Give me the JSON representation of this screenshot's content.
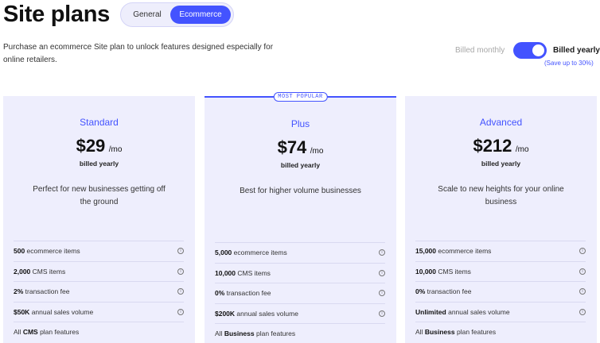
{
  "header": {
    "title": "Site plans",
    "tabs": [
      {
        "label": "General",
        "active": false
      },
      {
        "label": "Ecommerce",
        "active": true
      }
    ]
  },
  "intro": "Purchase an ecommerce Site plan to unlock features designed especially for online retailers.",
  "billing": {
    "monthly_label": "Billed monthly",
    "yearly_label": "Billed yearly",
    "save_note": "(Save up to 30%)",
    "yearly_selected": true
  },
  "plans": [
    {
      "name": "Standard",
      "price": "$29",
      "per": "/mo",
      "billed": "billed yearly",
      "desc": "Perfect for new businesses getting off the ground",
      "features": [
        {
          "strong": "500",
          "text": " ecommerce items"
        },
        {
          "strong": "2,000",
          "text": " CMS items"
        },
        {
          "strong": "2%",
          "text": " transaction fee"
        },
        {
          "strong": "$50K",
          "text": " annual sales volume"
        },
        {
          "pre": "All ",
          "strong": "CMS",
          "text": " plan features"
        }
      ]
    },
    {
      "name": "Plus",
      "badge": "MOST POPULAR",
      "price": "$74",
      "per": "/mo",
      "billed": "billed yearly",
      "desc": "Best for higher volume businesses",
      "features": [
        {
          "strong": "5,000",
          "text": " ecommerce items"
        },
        {
          "strong": "10,000",
          "text": " CMS items"
        },
        {
          "strong": "0%",
          "text": " transaction fee"
        },
        {
          "strong": "$200K",
          "text": " annual sales volume"
        },
        {
          "pre": "All ",
          "strong": "Business",
          "text": " plan features"
        }
      ]
    },
    {
      "name": "Advanced",
      "price": "$212",
      "per": "/mo",
      "billed": "billed yearly",
      "desc": "Scale to new heights for your online business",
      "features": [
        {
          "strong": "15,000",
          "text": " ecommerce items"
        },
        {
          "strong": "10,000",
          "text": " CMS items"
        },
        {
          "strong": "0%",
          "text": " transaction fee"
        },
        {
          "strong": "Unlimited",
          "text": " annual sales volume"
        },
        {
          "pre": "All ",
          "strong": "Business",
          "text": " plan features"
        }
      ]
    }
  ],
  "icons": {
    "info": "info-icon",
    "info_glyph": "i"
  },
  "colors": {
    "accent": "#4353ff",
    "card_bg": "#eeeefd"
  }
}
